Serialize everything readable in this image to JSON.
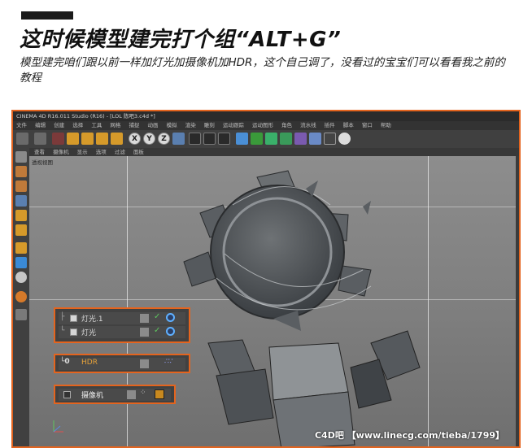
{
  "header": {
    "title": "这时候模型建完打个组“ALT+G”",
    "description": "模型建完咱们跟以前一样加灯光加摄像机加HDR，这个自己调了，没看过的宝宝们可以看看我之前的教程"
  },
  "app": {
    "window_title": "CINEMA 4D R16.011 Studio (R16) - [LOL 陈吧3.c4d *]",
    "menu": [
      "文件",
      "编辑",
      "创建",
      "选择",
      "工具",
      "网格",
      "捕捉",
      "动画",
      "模拟",
      "渲染",
      "雕刻",
      "运动跟踪",
      "运动图形",
      "角色",
      "流水线",
      "插件",
      "脚本",
      "窗口",
      "帮助"
    ],
    "viewport_menu": [
      "查看",
      "摄像机",
      "显示",
      "选项",
      "过滤",
      "面板"
    ],
    "viewport_label": "透视视图",
    "toolbar_axes": [
      "X",
      "Y",
      "Z"
    ]
  },
  "objects": {
    "lights": [
      {
        "name": "灯光.1"
      },
      {
        "name": "灯光"
      }
    ],
    "hdr": {
      "name": "HDR"
    },
    "camera": {
      "name": "摄像机"
    }
  },
  "watermark": "C4D吧 【www.linecg.com/tieba/1799】",
  "colors": {
    "accent": "#e4641e",
    "hdr_label": "#e4a13a",
    "check": "#5ec55e",
    "target": "#5fb0ff"
  }
}
